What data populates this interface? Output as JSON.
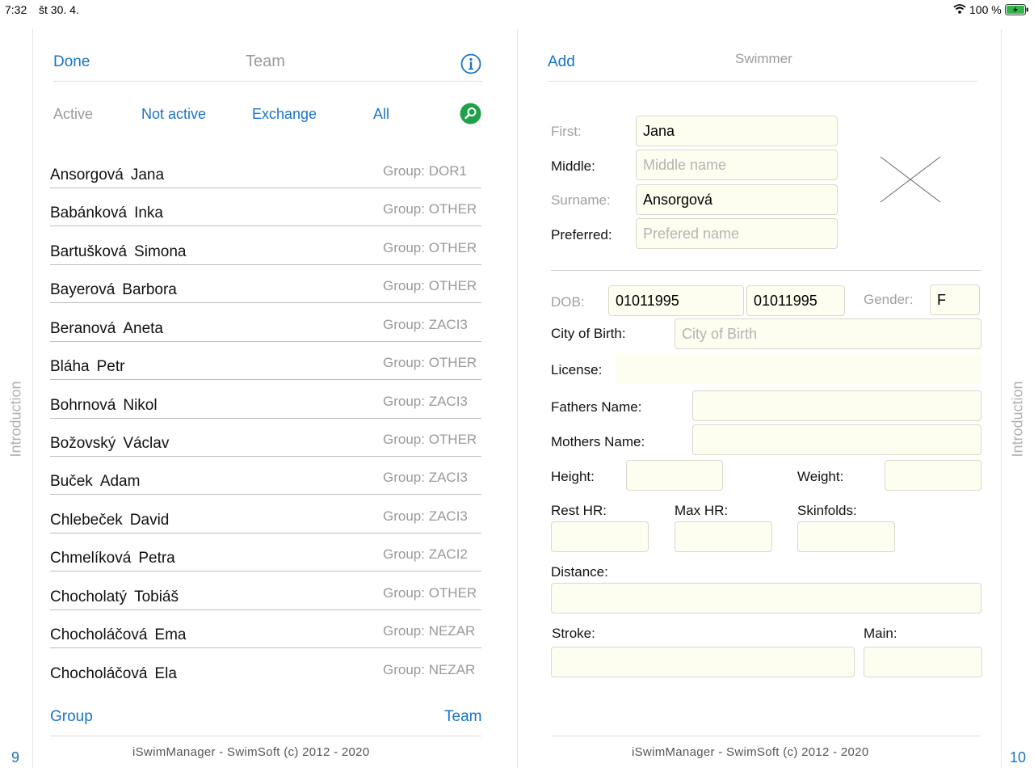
{
  "status_bar": {
    "time": "7:32",
    "date": "št 30. 4.",
    "battery": "100 %"
  },
  "left_page": {
    "done_label": "Done",
    "title": "Team",
    "filters": {
      "active": "Active",
      "not_active": "Not active",
      "exchange": "Exchange",
      "all": "All"
    },
    "swimmers": [
      {
        "surname": "Ansorgová",
        "first": "Jana",
        "group": "Group: DOR1"
      },
      {
        "surname": "Babánková",
        "first": "Inka",
        "group": "Group: OTHER"
      },
      {
        "surname": "Bartušková",
        "first": "Simona",
        "group": "Group: OTHER"
      },
      {
        "surname": "Bayerová",
        "first": "Barbora",
        "group": "Group: OTHER"
      },
      {
        "surname": "Beranová",
        "first": "Aneta",
        "group": "Group: ZACI3"
      },
      {
        "surname": "Bláha",
        "first": "Petr",
        "group": "Group: OTHER"
      },
      {
        "surname": "Bohrnová",
        "first": "Nikol",
        "group": "Group: ZACI3"
      },
      {
        "surname": "Božovský",
        "first": "Václav",
        "group": "Group: OTHER"
      },
      {
        "surname": "Buček",
        "first": "Adam",
        "group": "Group: ZACI3"
      },
      {
        "surname": "Chlebeček",
        "first": "David",
        "group": "Group: ZACI3"
      },
      {
        "surname": "Chmelíková",
        "first": "Petra",
        "group": "Group: ZACI2"
      },
      {
        "surname": "Chocholatý",
        "first": "Tobiáš",
        "group": "Group: OTHER"
      },
      {
        "surname": "Chocholáčová",
        "first": "Ema",
        "group": "Group: NEZAR"
      },
      {
        "surname": "Chocholáčová",
        "first": "Ela",
        "group": "Group: NEZAR"
      }
    ],
    "group_label": "Group",
    "team_label": "Team",
    "footer": "iSwimManager - SwimSoft (c) 2012 - 2020",
    "page_number": "9",
    "side_tab": "Introduction"
  },
  "right_page": {
    "add_label": "Add",
    "title": "Swimmer",
    "labels": {
      "first": "First:",
      "middle": "Middle:",
      "surname": "Surname:",
      "preferred": "Preferred:",
      "dob": "DOB:",
      "gender": "Gender:",
      "city_of_birth": "City of Birth:",
      "license": "License:",
      "fathers_name": "Fathers Name:",
      "mothers_name": "Mothers Name:",
      "height": "Height:",
      "weight": "Weight:",
      "rest_hr": "Rest HR:",
      "max_hr": "Max HR:",
      "skinfolds": "Skinfolds:",
      "distance": "Distance:",
      "stroke": "Stroke:",
      "main": "Main:"
    },
    "values": {
      "first": "Jana",
      "surname": "Ansorgová",
      "dob_1": "01011995",
      "dob_2": "01011995",
      "gender": "F"
    },
    "placeholders": {
      "middle": "Middle name",
      "preferred": "Prefered name",
      "city_of_birth": "City of Birth"
    },
    "footer": "iSwimManager - SwimSoft (c) 2012 - 2020",
    "page_number": "10",
    "side_tab": "Introduction"
  },
  "colors": {
    "accent": "#1a73c8",
    "field_bg": "#fdfdf0",
    "search_green": "#1fa04a"
  }
}
